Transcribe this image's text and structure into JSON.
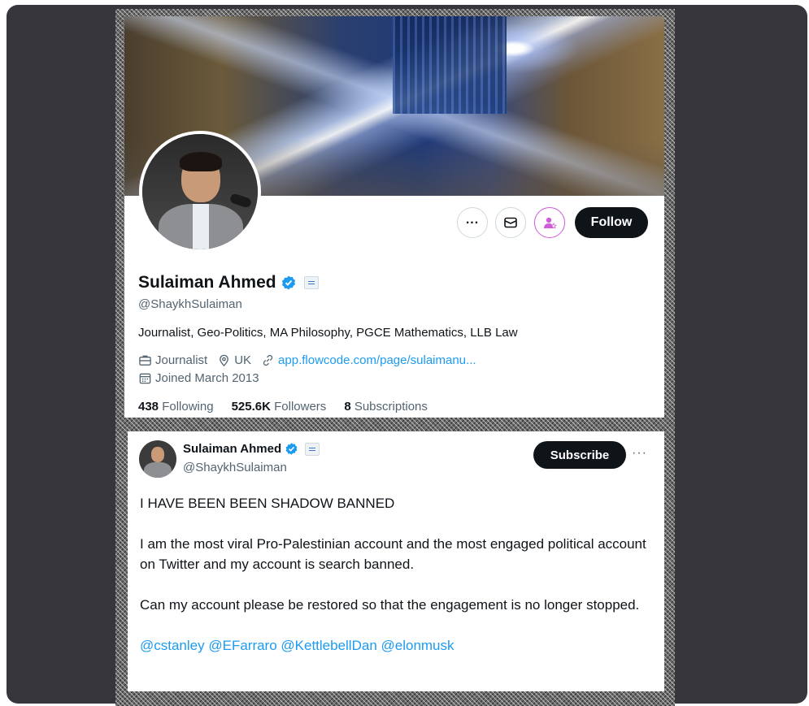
{
  "profile": {
    "name": "Sulaiman Ahmed",
    "handle": "@ShaykhSulaiman",
    "bio": "Journalist, Geo-Politics, MA Philosophy, PGCE Mathematics, LLB Law",
    "category": "Journalist",
    "location": "UK",
    "website": "app.flowcode.com/page/sulaimanu...",
    "joined": "Joined March 2013",
    "follow_label": "Follow",
    "stats": {
      "following_count": "438",
      "following_label": "Following",
      "followers_count": "525.6K",
      "followers_label": "Followers",
      "subscriptions_count": "8",
      "subscriptions_label": "Subscriptions"
    }
  },
  "tweet": {
    "author_name": "Sulaiman Ahmed",
    "author_handle": "@ShaykhSulaiman",
    "subscribe_label": "Subscribe",
    "more_label": "···",
    "paragraphs": [
      "I HAVE BEEN BEEN SHADOW BANNED",
      "I am the most viral Pro-Palestinian account and the most engaged political account on Twitter and my account is search banned.",
      "Can my account please be restored so that the engagement is no longer stopped."
    ],
    "mentions": "@cstanley @EFarraro @KettlebellDan @elonmusk"
  },
  "icons": [
    "more-icon",
    "mail-icon",
    "subscription-icon",
    "verified-icon",
    "affiliation-badge-icon",
    "briefcase-icon",
    "location-pin-icon",
    "link-icon",
    "calendar-icon"
  ],
  "colors": {
    "accent_blue": "#1d9bf0",
    "button_dark": "#0f1419",
    "secondary_text": "#536471",
    "subscription_pink": "#d15bd8",
    "backdrop": "#36363c"
  }
}
